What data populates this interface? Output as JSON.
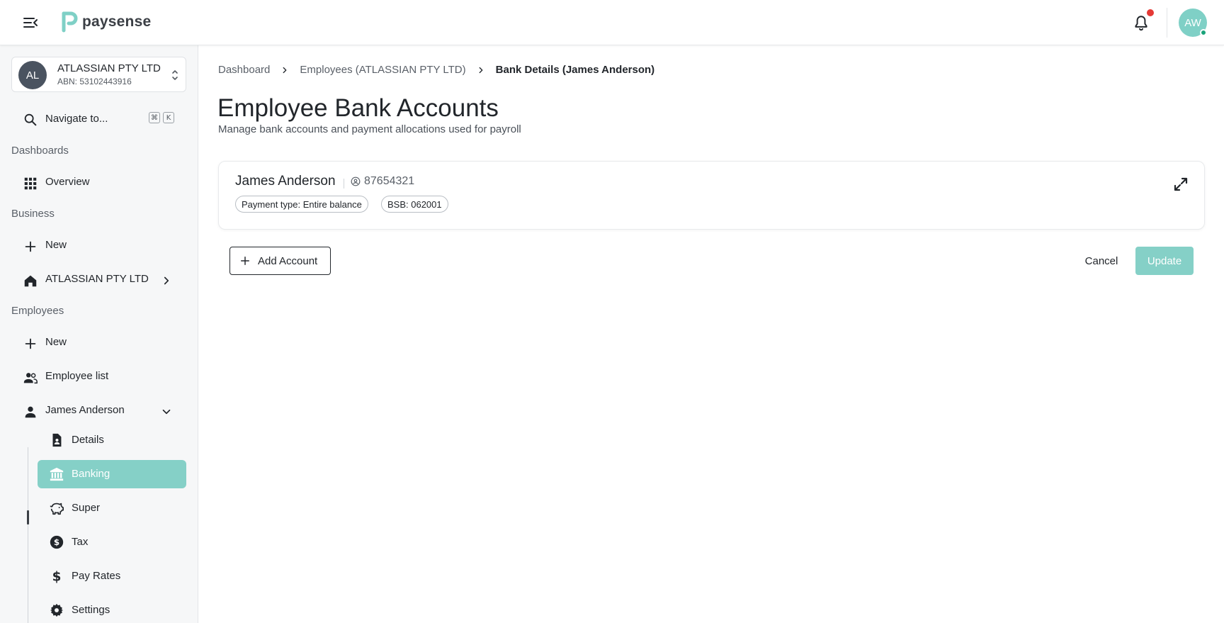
{
  "app": {
    "logo_text": "paysense",
    "brand_color": "#7fd0c6",
    "user_initials": "AW",
    "notification_indicator": true
  },
  "sidebar": {
    "org": {
      "initials": "AL",
      "name": "ATLASSIAN PTY LTD",
      "abn": "ABN: 53102443916"
    },
    "search": {
      "label": "Navigate to...",
      "shortcut_keys": [
        "⌘",
        "K"
      ]
    },
    "sections": {
      "dashboards": "Dashboards",
      "business": "Business",
      "employees": "Employees"
    },
    "items": {
      "overview": "Overview",
      "business_new": "New",
      "business_org": "ATLASSIAN PTY LTD",
      "employees_new": "New",
      "employee_list": "Employee list",
      "employee_name": "James Anderson"
    },
    "employee_subitems": [
      {
        "label": "Details",
        "icon": "document-icon",
        "active": false
      },
      {
        "label": "Banking",
        "icon": "bank-icon",
        "active": true
      },
      {
        "label": "Super",
        "icon": "piggy-bank-icon",
        "active": false
      },
      {
        "label": "Tax",
        "icon": "dollar-circle-icon",
        "active": false
      },
      {
        "label": "Pay Rates",
        "icon": "dollar-icon",
        "active": false
      },
      {
        "label": "Settings",
        "icon": "gear-icon",
        "active": false
      }
    ]
  },
  "main": {
    "breadcrumb": [
      "Dashboard",
      "Employees (ATLASSIAN PTY LTD)",
      "Bank Details (James Anderson)"
    ],
    "title": "Employee Bank Accounts",
    "subtitle": "Manage bank accounts and payment allocations used for payroll",
    "employee_card": {
      "name": "James Anderson",
      "employee_id": "87654321",
      "chips": [
        "Payment type: Entire balance",
        "BSB: 062001"
      ]
    },
    "actions": {
      "add_account": "Add Account",
      "cancel": "Cancel",
      "update": "Update"
    }
  }
}
